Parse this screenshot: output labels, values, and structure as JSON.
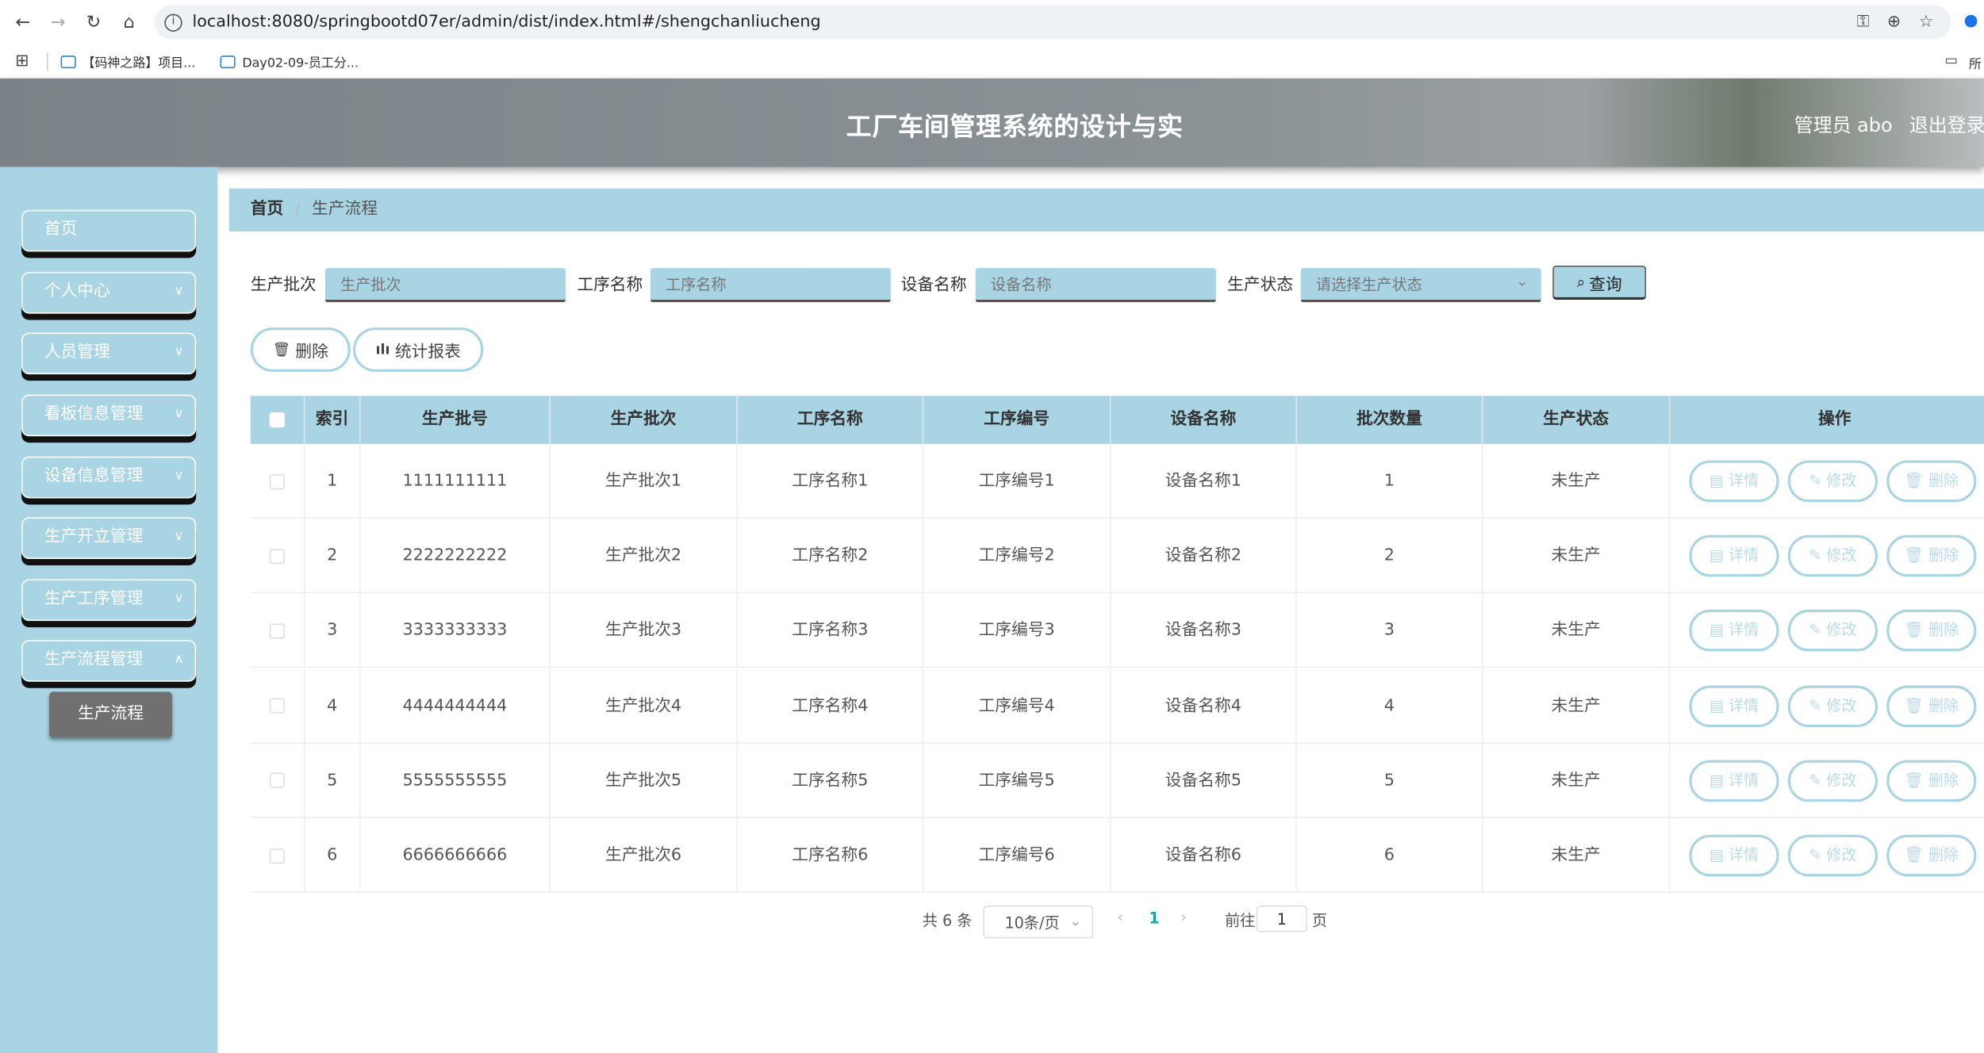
{
  "browser": {
    "url": "localhost:8080/springbootd07er/admin/dist/index.html#/shengchanliucheng",
    "bookmarks": [
      "【码神之路】项目...",
      "Day02-09-员工分..."
    ],
    "bookmarks_right": "所"
  },
  "header": {
    "title": "工厂车间管理系统的设计与实",
    "user": "管理员 abo",
    "logout": "退出登录"
  },
  "sidebar": {
    "items": [
      {
        "label": "首页"
      },
      {
        "label": "个人中心"
      },
      {
        "label": "人员管理"
      },
      {
        "label": "看板信息管理"
      },
      {
        "label": "设备信息管理"
      },
      {
        "label": "生产开立管理"
      },
      {
        "label": "生产工序管理"
      },
      {
        "label": "生产流程管理"
      }
    ],
    "active_sub": "生产流程"
  },
  "breadcrumb": {
    "home": "首页",
    "sep": "/",
    "current": "生产流程"
  },
  "filters": [
    {
      "label": "生产批次",
      "placeholder": "生产批次"
    },
    {
      "label": "工序名称",
      "placeholder": "工序名称"
    },
    {
      "label": "设备名称",
      "placeholder": "设备名称"
    },
    {
      "label": "生产状态",
      "placeholder": "请选择生产状态"
    }
  ],
  "query_label": "查询",
  "toolbar": {
    "delete_label": "删除",
    "report_label": "统计报表"
  },
  "table": {
    "columns": [
      "索引",
      "生产批号",
      "生产批次",
      "工序名称",
      "工序编号",
      "设备名称",
      "批次数量",
      "生产状态",
      "操作"
    ],
    "rows": [
      [
        "1",
        "1111111111",
        "生产批次1",
        "工序名称1",
        "工序编号1",
        "设备名称1",
        "1",
        "未生产"
      ],
      [
        "2",
        "2222222222",
        "生产批次2",
        "工序名称2",
        "工序编号2",
        "设备名称2",
        "2",
        "未生产"
      ],
      [
        "3",
        "3333333333",
        "生产批次3",
        "工序名称3",
        "工序编号3",
        "设备名称3",
        "3",
        "未生产"
      ],
      [
        "4",
        "4444444444",
        "生产批次4",
        "工序名称4",
        "工序编号4",
        "设备名称4",
        "4",
        "未生产"
      ],
      [
        "5",
        "5555555555",
        "生产批次5",
        "工序名称5",
        "工序编号5",
        "设备名称5",
        "5",
        "未生产"
      ],
      [
        "6",
        "6666666666",
        "生产批次6",
        "工序名称6",
        "工序编号6",
        "设备名称6",
        "6",
        "未生产"
      ]
    ],
    "actions": {
      "detail": "详情",
      "edit": "修改",
      "delete": "删除"
    }
  },
  "pagination": {
    "total": "共 6 条",
    "page_size": "10条/页",
    "current_page": "1",
    "goto_label": "前往",
    "goto_value": "1",
    "page_suffix": "页"
  },
  "colors": {
    "accent": "#a8d4e4",
    "header": "#858d91",
    "active_sub": "#707070",
    "page_active": "#1aa5a5"
  }
}
